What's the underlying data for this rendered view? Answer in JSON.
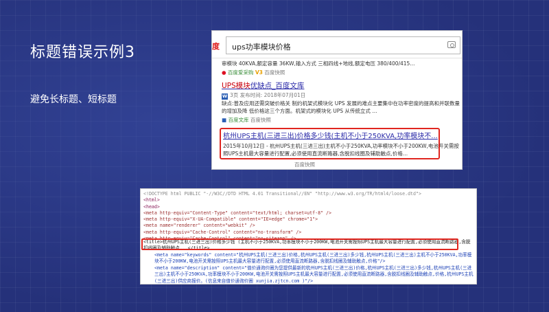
{
  "slide": {
    "title": "标题错误示例3",
    "subtitle": "避免长标题、短标题"
  },
  "search": {
    "logo_text": "度",
    "query": "ups功率模块价格",
    "results": [
      {
        "snippet_partial": "审模块 40KVA,额定容量 36KW,输入方式 三相四线+地线,额定电压 380/400/415...",
        "source": "百度爱采购",
        "badge": "V3",
        "snapshot": "百度快照"
      },
      {
        "title_hl": "UPS模块",
        "title_rest": "优缺点_百度文库",
        "pages_date": "3页 发布时间: 2018年07月01日",
        "snippet": "缺点:普及应用还需突破价格关 制约机架式模块化 UPS 发展的难点主要集中在功率密度的提高和并联数量的增加及降 低价格这三个方面。机架式的模块化 UPS 从传统立式 ...",
        "source": "百度文库",
        "snapshot": "百度快照"
      },
      {
        "title": "杭州UPS主机(三进三出)价格多少钱(主机不小于250KVA,功率模块不...",
        "snippet": "2015年10月12日 - 杭州UPS主机(三进三出)主机不小于250KVA,功率模块不小于200KW,电池开关需按照UPS主机最大容量进行配置,必须使用直流断路器,含脱扣线圈及辅助触点,价格...",
        "snapshot": "百度快照"
      }
    ]
  },
  "source_code": {
    "lines": [
      "<!DOCTYPE html PUBLIC \"-//W3C//DTD HTML 4.01 Transitional//EN\" \"http://www.w3.org/TR/html4/loose.dtd\">",
      "<html>",
      "<head>",
      "<meta http-equiv=\"Content-Type\" content=\"text/html; charset=utf-8\" />",
      "<meta http-equiv=\"X-UA-Compatible\" content=\"IE=edge\" chrome=\"1\">",
      "<meta name=\"renderer\" content=\"webkit\" />",
      "<meta http-equiv=\"Cache-Control\" content=\"no-transform\" />",
      "<meta http-equiv=\"Cache-Control\" content=\"no-siteapp\" />"
    ],
    "title_line": "<title>杭州UPS主机(三进三出)价格多少钱 (主机不小于250KVA,功率模块不小于200KW,电池开关需按照UPS主机最大容量进行配置,必须使用直流断路器,含脱扣线圈及辅助触点...</title>",
    "keywords_line": "<meta name=\"keywords\" content=\"杭州UPS主机(三进三出)价格,杭州UPS主机(三进三出)多少钱,杭州UPS主机(三进三出)主机不小于250KVA,功率模块不小于200KW,电池开关需按照UPS主机最大容量进行配置,必须使用直流断路器,含脱扣线圈及辅助触点,价格\"/>",
    "description_line": "<meta name=\"description\" content=\"值价通询价圈为您提供最新的杭州UPS主机(三进三出)价格,杭州UPS主机(三进三出)多少钱,杭州UPS主机(三进三出)主机不小于250KVA,功率模块不小于200KW,电池开关需按照UPS主机最大容量进行配置,必须使用直流断路器,含脱扣线圈及辅助触点,价格,杭州UPS主机(三进三出)供应商报价。(信息来自值价通询价圈 xunjia.zjtcn.com )\"/>"
  }
}
